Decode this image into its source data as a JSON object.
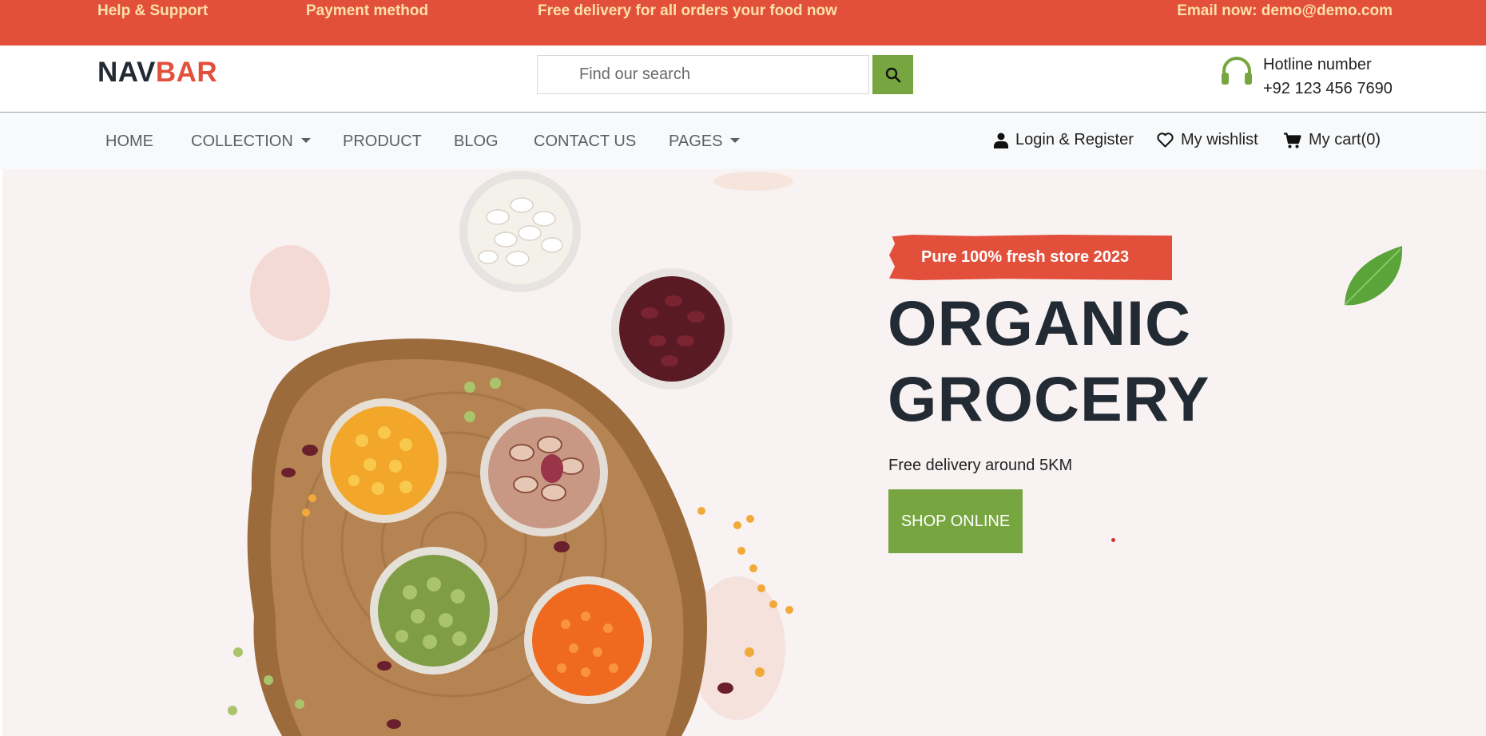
{
  "topbar": {
    "help": "Help & Support",
    "payment": "Payment method",
    "promo": "Free delivery for all orders your food now",
    "email": "Email now: demo@demo.com"
  },
  "header": {
    "logo_part1": "NAV",
    "logo_part2": "BAR",
    "search_placeholder": "Find our search",
    "hotline_title": "Hotline number",
    "hotline_phone": "+92 123 456 7690"
  },
  "nav": {
    "items": [
      {
        "label": "HOME"
      },
      {
        "label": "COLLECTION"
      },
      {
        "label": "PRODUCT"
      },
      {
        "label": "BLOG"
      },
      {
        "label": "CONTACT US"
      },
      {
        "label": "PAGES"
      }
    ],
    "login": "Login & Register",
    "wishlist": "My wishlist",
    "cart": "My cart(0)"
  },
  "hero": {
    "badge": "Pure 100% fresh store 2023",
    "title_line1": "ORGANIC",
    "title_line2": "GROCERY",
    "subtitle": "Free delivery around 5KM",
    "button": "SHOP ONLINE"
  },
  "colors": {
    "brand_red": "#e2503b",
    "brand_green": "#77a640",
    "topbar_text": "#fde1a6",
    "hero_bg": "#f9f2f2"
  },
  "icons": [
    "search-icon",
    "headset-icon",
    "user-icon",
    "heart-icon",
    "cart-icon",
    "leaf-icon"
  ]
}
